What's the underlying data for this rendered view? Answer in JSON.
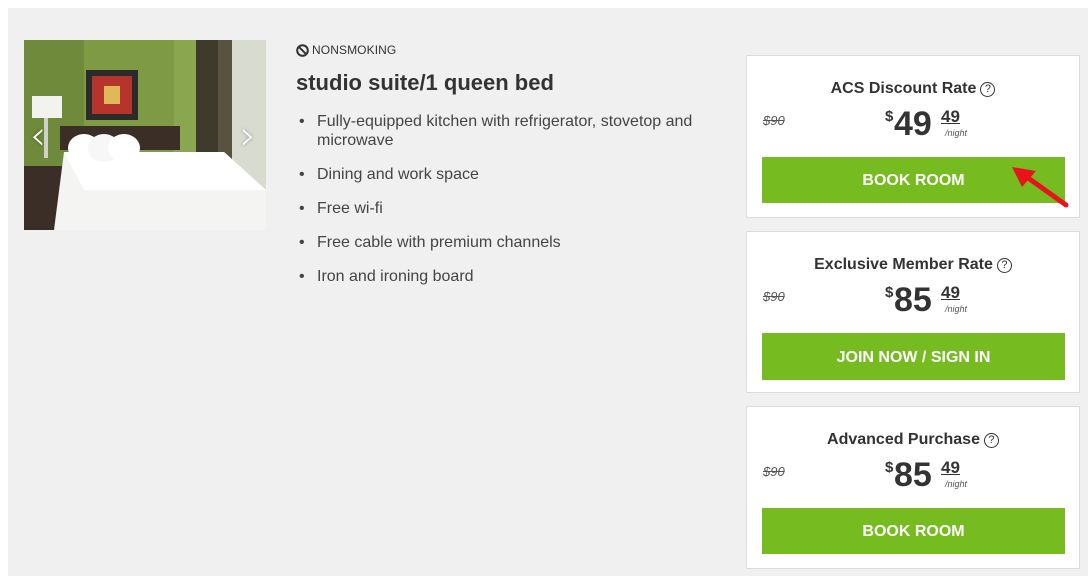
{
  "room": {
    "smoking_label": "NONSMOKING",
    "title": "studio suite/1 queen bed",
    "amenities": [
      "Fully-equipped kitchen with refrigerator, stovetop and microwave",
      "Dining and work space",
      "Free wi-fi",
      "Free cable with premium channels",
      "Iron and ironing board"
    ],
    "carousel": {
      "prev_icon": "chevron-left-icon",
      "next_icon": "chevron-right-icon"
    }
  },
  "rates": [
    {
      "name": "ACS Discount Rate",
      "old_price": "$90",
      "currency": "$",
      "price_whole": "49",
      "price_cents": "49",
      "per": "/night",
      "button": "BOOK ROOM"
    },
    {
      "name": "Exclusive Member Rate",
      "old_price": "$90",
      "currency": "$",
      "price_whole": "85",
      "price_cents": "49",
      "per": "/night",
      "button": "JOIN NOW / SIGN IN"
    },
    {
      "name": "Advanced Purchase",
      "old_price": "$90",
      "currency": "$",
      "price_whole": "85",
      "price_cents": "49",
      "per": "/night",
      "button": "BOOK ROOM"
    }
  ],
  "help_icon_glyph": "?",
  "colors": {
    "accent_green": "#76bc21",
    "annotation_red": "#e8141b",
    "panel_bg": "#f0f0f0"
  }
}
